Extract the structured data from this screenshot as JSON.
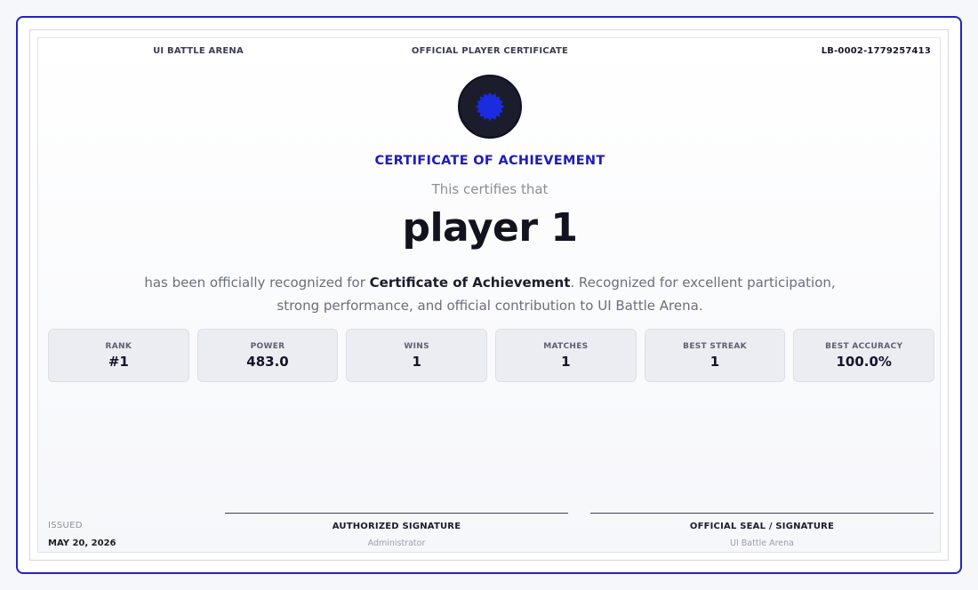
{
  "header": {
    "brand": "UI BATTLE ARENA",
    "document_type": "OFFICIAL PLAYER CERTIFICATE",
    "certificate_id": "LB-0002-1779257413"
  },
  "seal": {
    "icon": "badge-gear-icon",
    "color": "#1a2be0"
  },
  "certificate": {
    "title": "CERTIFICATE OF ACHIEVEMENT",
    "certifies_text": "This certifies that",
    "player_name": "player 1",
    "description_prefix": "has been officially recognized for ",
    "description_award": "Certificate of Achievement",
    "description_suffix": ". Recognized for excellent participation, strong performance, and official contribution to UI Battle Arena."
  },
  "stats": [
    {
      "label": "RANK",
      "value": "#1"
    },
    {
      "label": "POWER",
      "value": "483.0"
    },
    {
      "label": "WINS",
      "value": "1"
    },
    {
      "label": "MATCHES",
      "value": "1"
    },
    {
      "label": "BEST STREAK",
      "value": "1"
    },
    {
      "label": "BEST ACCURACY",
      "value": "100.0%"
    }
  ],
  "footer": {
    "issued_label": "ISSUED",
    "issued_date": "MAY 20, 2026",
    "signature_1": {
      "title": "AUTHORIZED SIGNATURE",
      "subtitle": "Administrator"
    },
    "signature_2": {
      "title": "OFFICIAL SEAL / SIGNATURE",
      "subtitle": "UI Battle Arena"
    }
  },
  "colors": {
    "accent": "#2323c0",
    "title": "#1c1cbc",
    "seal_background": "#1b1d2c"
  }
}
